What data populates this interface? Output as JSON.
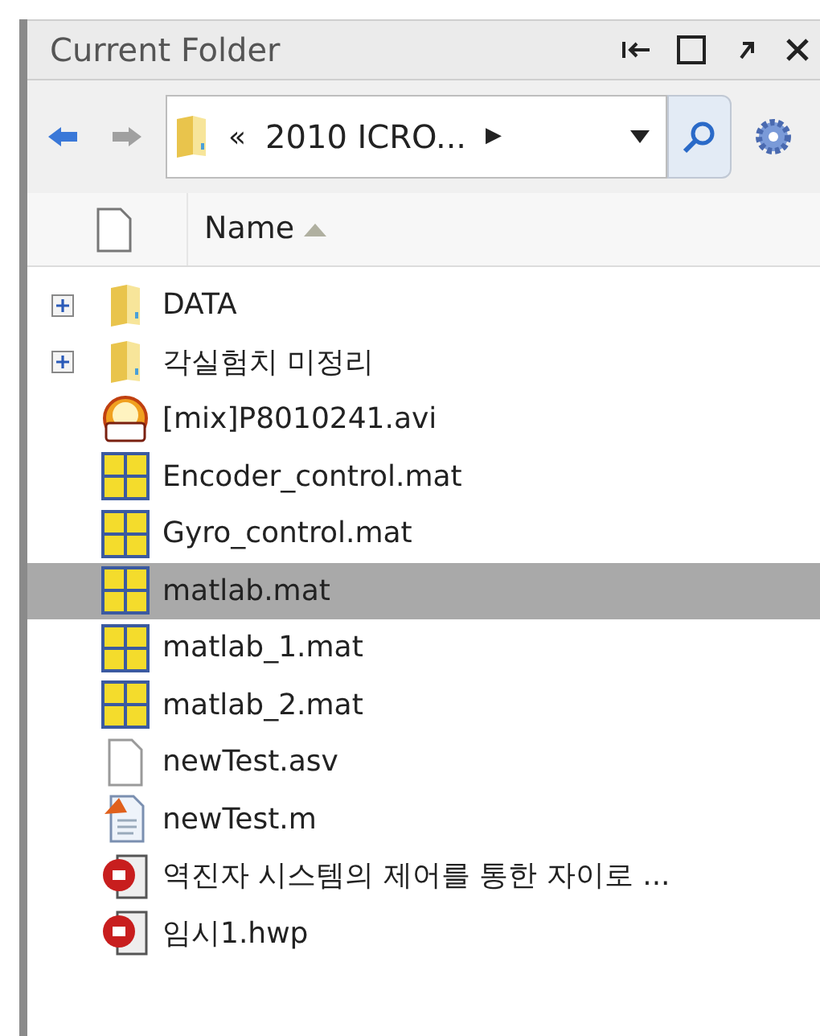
{
  "window": {
    "title": "Current Folder"
  },
  "address": {
    "chevron": "«",
    "path": "2010 ICRO...",
    "separator": "▶"
  },
  "header": {
    "label": "Name"
  },
  "files": [
    {
      "name": "DATA",
      "kind": "folder",
      "expanded": false,
      "selected": false
    },
    {
      "name": "각실험치 미정리",
      "kind": "folder",
      "expanded": false,
      "selected": false
    },
    {
      "name": "[mix]P8010241.avi",
      "kind": "avi",
      "selected": false
    },
    {
      "name": "Encoder_control.mat",
      "kind": "mat",
      "selected": false
    },
    {
      "name": "Gyro_control.mat",
      "kind": "mat",
      "selected": false
    },
    {
      "name": "matlab.mat",
      "kind": "mat",
      "selected": true
    },
    {
      "name": "matlab_1.mat",
      "kind": "mat",
      "selected": false
    },
    {
      "name": "matlab_2.mat",
      "kind": "mat",
      "selected": false
    },
    {
      "name": "newTest.asv",
      "kind": "asv",
      "selected": false
    },
    {
      "name": "newTest.m",
      "kind": "m",
      "selected": false
    },
    {
      "name": "역진자 시스템의 제어를 통한 자이로 ...",
      "kind": "hwp",
      "selected": false
    },
    {
      "name": "임시1.hwp",
      "kind": "hwp",
      "selected": false
    }
  ]
}
